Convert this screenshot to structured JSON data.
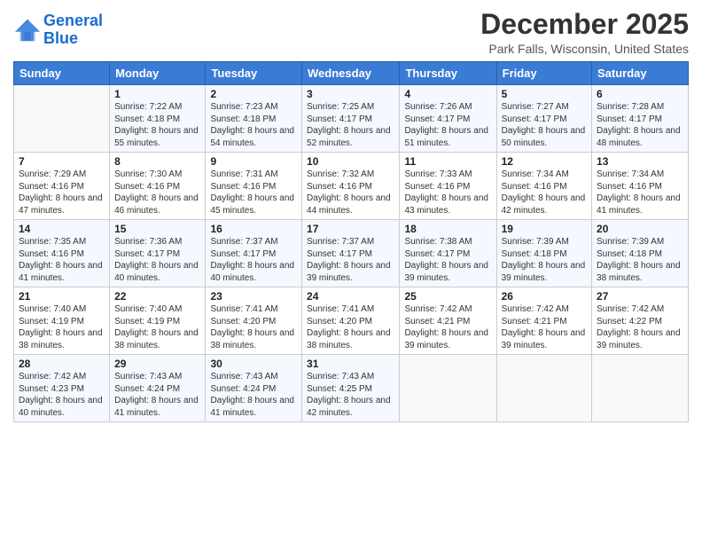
{
  "logo": {
    "text_general": "General",
    "text_blue": "Blue"
  },
  "title": "December 2025",
  "subtitle": "Park Falls, Wisconsin, United States",
  "days_of_week": [
    "Sunday",
    "Monday",
    "Tuesday",
    "Wednesday",
    "Thursday",
    "Friday",
    "Saturday"
  ],
  "weeks": [
    [
      {
        "day": "",
        "sunrise": "",
        "sunset": "",
        "daylight": ""
      },
      {
        "day": "1",
        "sunrise": "Sunrise: 7:22 AM",
        "sunset": "Sunset: 4:18 PM",
        "daylight": "Daylight: 8 hours and 55 minutes."
      },
      {
        "day": "2",
        "sunrise": "Sunrise: 7:23 AM",
        "sunset": "Sunset: 4:18 PM",
        "daylight": "Daylight: 8 hours and 54 minutes."
      },
      {
        "day": "3",
        "sunrise": "Sunrise: 7:25 AM",
        "sunset": "Sunset: 4:17 PM",
        "daylight": "Daylight: 8 hours and 52 minutes."
      },
      {
        "day": "4",
        "sunrise": "Sunrise: 7:26 AM",
        "sunset": "Sunset: 4:17 PM",
        "daylight": "Daylight: 8 hours and 51 minutes."
      },
      {
        "day": "5",
        "sunrise": "Sunrise: 7:27 AM",
        "sunset": "Sunset: 4:17 PM",
        "daylight": "Daylight: 8 hours and 50 minutes."
      },
      {
        "day": "6",
        "sunrise": "Sunrise: 7:28 AM",
        "sunset": "Sunset: 4:17 PM",
        "daylight": "Daylight: 8 hours and 48 minutes."
      }
    ],
    [
      {
        "day": "7",
        "sunrise": "Sunrise: 7:29 AM",
        "sunset": "Sunset: 4:16 PM",
        "daylight": "Daylight: 8 hours and 47 minutes."
      },
      {
        "day": "8",
        "sunrise": "Sunrise: 7:30 AM",
        "sunset": "Sunset: 4:16 PM",
        "daylight": "Daylight: 8 hours and 46 minutes."
      },
      {
        "day": "9",
        "sunrise": "Sunrise: 7:31 AM",
        "sunset": "Sunset: 4:16 PM",
        "daylight": "Daylight: 8 hours and 45 minutes."
      },
      {
        "day": "10",
        "sunrise": "Sunrise: 7:32 AM",
        "sunset": "Sunset: 4:16 PM",
        "daylight": "Daylight: 8 hours and 44 minutes."
      },
      {
        "day": "11",
        "sunrise": "Sunrise: 7:33 AM",
        "sunset": "Sunset: 4:16 PM",
        "daylight": "Daylight: 8 hours and 43 minutes."
      },
      {
        "day": "12",
        "sunrise": "Sunrise: 7:34 AM",
        "sunset": "Sunset: 4:16 PM",
        "daylight": "Daylight: 8 hours and 42 minutes."
      },
      {
        "day": "13",
        "sunrise": "Sunrise: 7:34 AM",
        "sunset": "Sunset: 4:16 PM",
        "daylight": "Daylight: 8 hours and 41 minutes."
      }
    ],
    [
      {
        "day": "14",
        "sunrise": "Sunrise: 7:35 AM",
        "sunset": "Sunset: 4:16 PM",
        "daylight": "Daylight: 8 hours and 41 minutes."
      },
      {
        "day": "15",
        "sunrise": "Sunrise: 7:36 AM",
        "sunset": "Sunset: 4:17 PM",
        "daylight": "Daylight: 8 hours and 40 minutes."
      },
      {
        "day": "16",
        "sunrise": "Sunrise: 7:37 AM",
        "sunset": "Sunset: 4:17 PM",
        "daylight": "Daylight: 8 hours and 40 minutes."
      },
      {
        "day": "17",
        "sunrise": "Sunrise: 7:37 AM",
        "sunset": "Sunset: 4:17 PM",
        "daylight": "Daylight: 8 hours and 39 minutes."
      },
      {
        "day": "18",
        "sunrise": "Sunrise: 7:38 AM",
        "sunset": "Sunset: 4:17 PM",
        "daylight": "Daylight: 8 hours and 39 minutes."
      },
      {
        "day": "19",
        "sunrise": "Sunrise: 7:39 AM",
        "sunset": "Sunset: 4:18 PM",
        "daylight": "Daylight: 8 hours and 39 minutes."
      },
      {
        "day": "20",
        "sunrise": "Sunrise: 7:39 AM",
        "sunset": "Sunset: 4:18 PM",
        "daylight": "Daylight: 8 hours and 38 minutes."
      }
    ],
    [
      {
        "day": "21",
        "sunrise": "Sunrise: 7:40 AM",
        "sunset": "Sunset: 4:19 PM",
        "daylight": "Daylight: 8 hours and 38 minutes."
      },
      {
        "day": "22",
        "sunrise": "Sunrise: 7:40 AM",
        "sunset": "Sunset: 4:19 PM",
        "daylight": "Daylight: 8 hours and 38 minutes."
      },
      {
        "day": "23",
        "sunrise": "Sunrise: 7:41 AM",
        "sunset": "Sunset: 4:20 PM",
        "daylight": "Daylight: 8 hours and 38 minutes."
      },
      {
        "day": "24",
        "sunrise": "Sunrise: 7:41 AM",
        "sunset": "Sunset: 4:20 PM",
        "daylight": "Daylight: 8 hours and 38 minutes."
      },
      {
        "day": "25",
        "sunrise": "Sunrise: 7:42 AM",
        "sunset": "Sunset: 4:21 PM",
        "daylight": "Daylight: 8 hours and 39 minutes."
      },
      {
        "day": "26",
        "sunrise": "Sunrise: 7:42 AM",
        "sunset": "Sunset: 4:21 PM",
        "daylight": "Daylight: 8 hours and 39 minutes."
      },
      {
        "day": "27",
        "sunrise": "Sunrise: 7:42 AM",
        "sunset": "Sunset: 4:22 PM",
        "daylight": "Daylight: 8 hours and 39 minutes."
      }
    ],
    [
      {
        "day": "28",
        "sunrise": "Sunrise: 7:42 AM",
        "sunset": "Sunset: 4:23 PM",
        "daylight": "Daylight: 8 hours and 40 minutes."
      },
      {
        "day": "29",
        "sunrise": "Sunrise: 7:43 AM",
        "sunset": "Sunset: 4:24 PM",
        "daylight": "Daylight: 8 hours and 41 minutes."
      },
      {
        "day": "30",
        "sunrise": "Sunrise: 7:43 AM",
        "sunset": "Sunset: 4:24 PM",
        "daylight": "Daylight: 8 hours and 41 minutes."
      },
      {
        "day": "31",
        "sunrise": "Sunrise: 7:43 AM",
        "sunset": "Sunset: 4:25 PM",
        "daylight": "Daylight: 8 hours and 42 minutes."
      },
      {
        "day": "",
        "sunrise": "",
        "sunset": "",
        "daylight": ""
      },
      {
        "day": "",
        "sunrise": "",
        "sunset": "",
        "daylight": ""
      },
      {
        "day": "",
        "sunrise": "",
        "sunset": "",
        "daylight": ""
      }
    ]
  ]
}
